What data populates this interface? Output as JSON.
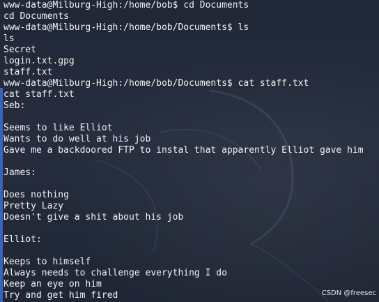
{
  "terminal": {
    "lines": [
      "www-data@Milburg-High:/home/bob$ cd Documents",
      "cd Documents",
      "www-data@Milburg-High:/home/bob/Documents$ ls",
      "ls",
      "Secret",
      "login.txt.gpg",
      "staff.txt",
      "www-data@Milburg-High:/home/bob/Documents$ cat staff.txt",
      "cat staff.txt",
      "Seb:",
      "",
      "Seems to like Elliot",
      "Wants to do well at his job",
      "Gave me a backdoored FTP to instal that apparently Elliot gave him",
      "",
      "James:",
      "",
      "Does nothing",
      "Pretty Lazy",
      "Doesn't give a shit about his job",
      "",
      "Elliot:",
      "",
      "Keeps to himself",
      "Always needs to challenge everything I do",
      "Keep an eye on him",
      "Try and get him fired"
    ]
  },
  "watermark": "CSDN @freesec"
}
